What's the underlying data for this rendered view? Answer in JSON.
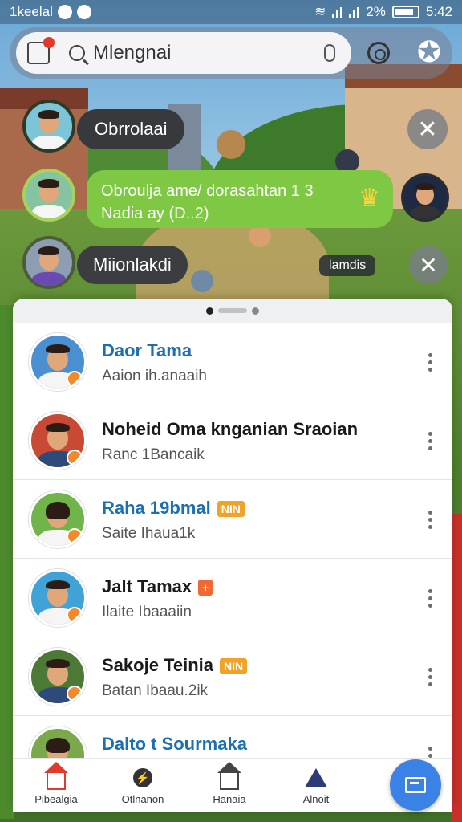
{
  "status_bar": {
    "left_text": "1keelal",
    "battery_text": "2%",
    "time": "5:42"
  },
  "search": {
    "value": "Mlengnai"
  },
  "chat_overlay": {
    "bubble_1": "Obrrolaai",
    "bubble_2_line1": "Obroulja ame/ dorasahtan 1 3",
    "bubble_2_line2": "Nadia ay (D..2)",
    "bubble_3": "Miionlakdi",
    "tag_3": "lamdis"
  },
  "contacts": [
    {
      "name": "Daor Tama",
      "status": "Aaion ih.anaaih",
      "name_color": "blue",
      "badge": ""
    },
    {
      "name": "Noheid Oma knganian Sraoian",
      "status": "Ranc 1Bancaik",
      "name_color": "dark",
      "badge": ""
    },
    {
      "name": "Raha 19bmal",
      "status": "Saite Ihaua1k",
      "name_color": "blue",
      "badge": "NIN"
    },
    {
      "name": "Jalt Tamax",
      "status": "Ilaite Ibaaaiin",
      "name_color": "dark",
      "badge": "+"
    },
    {
      "name": "Sakoje Teinia",
      "status": "Batan Ibaau.2ik",
      "name_color": "dark",
      "badge": "NIN"
    },
    {
      "name": "Dalto t Sourmaka",
      "status": "",
      "name_color": "blue",
      "badge": ""
    }
  ],
  "bottom_nav": [
    {
      "label": "Pibealgia",
      "icon": "home-icon"
    },
    {
      "label": "Otlnanon",
      "icon": "bolt-icon"
    },
    {
      "label": "Hanaia",
      "icon": "home-outline-icon"
    },
    {
      "label": "Alnoit",
      "icon": "triangle-icon"
    }
  ],
  "colors": {
    "accent": "#3b82e6",
    "bubble_green": "#7ec843",
    "name_blue": "#1c6fb0"
  }
}
